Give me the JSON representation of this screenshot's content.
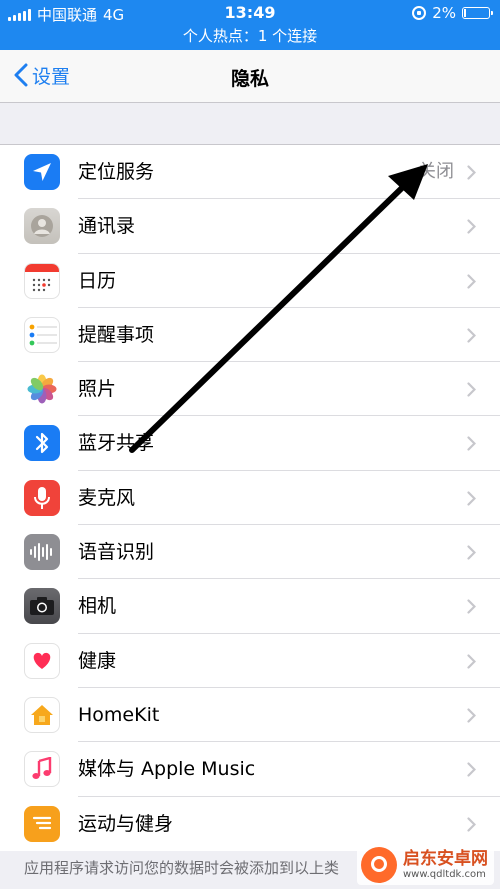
{
  "status_bar": {
    "carrier": "中国联通",
    "network": "4G",
    "time": "13:49",
    "battery": "2%",
    "hotspot": "个人热点：1 个连接"
  },
  "nav": {
    "back_label": "设置",
    "title": "隐私"
  },
  "rows": [
    {
      "label": "定位服务",
      "value": "关闭",
      "icon": "location-arrow-icon"
    },
    {
      "label": "通讯录",
      "value": "",
      "icon": "contacts-icon"
    },
    {
      "label": "日历",
      "value": "",
      "icon": "calendar-icon"
    },
    {
      "label": "提醒事项",
      "value": "",
      "icon": "reminders-icon"
    },
    {
      "label": "照片",
      "value": "",
      "icon": "photos-icon"
    },
    {
      "label": "蓝牙共享",
      "value": "",
      "icon": "bluetooth-icon"
    },
    {
      "label": "麦克风",
      "value": "",
      "icon": "microphone-icon"
    },
    {
      "label": "语音识别",
      "value": "",
      "icon": "speech-recognition-icon"
    },
    {
      "label": "相机",
      "value": "",
      "icon": "camera-icon"
    },
    {
      "label": "健康",
      "value": "",
      "icon": "health-heart-icon"
    },
    {
      "label": "HomeKit",
      "value": "",
      "icon": "homekit-house-icon"
    },
    {
      "label": "媒体与 Apple Music",
      "value": "",
      "icon": "music-note-icon"
    },
    {
      "label": "运动与健身",
      "value": "",
      "icon": "motion-fitness-icon"
    }
  ],
  "footer_note": "应用程序请求访问您的数据时会被添加到以上类",
  "watermark": {
    "title": "启东安卓网",
    "url": "www.qdltdk.com"
  },
  "colors": {
    "status_bar": "#1e88f0",
    "accent": "#1e7ff0",
    "annotation_arrow": "#000000"
  }
}
